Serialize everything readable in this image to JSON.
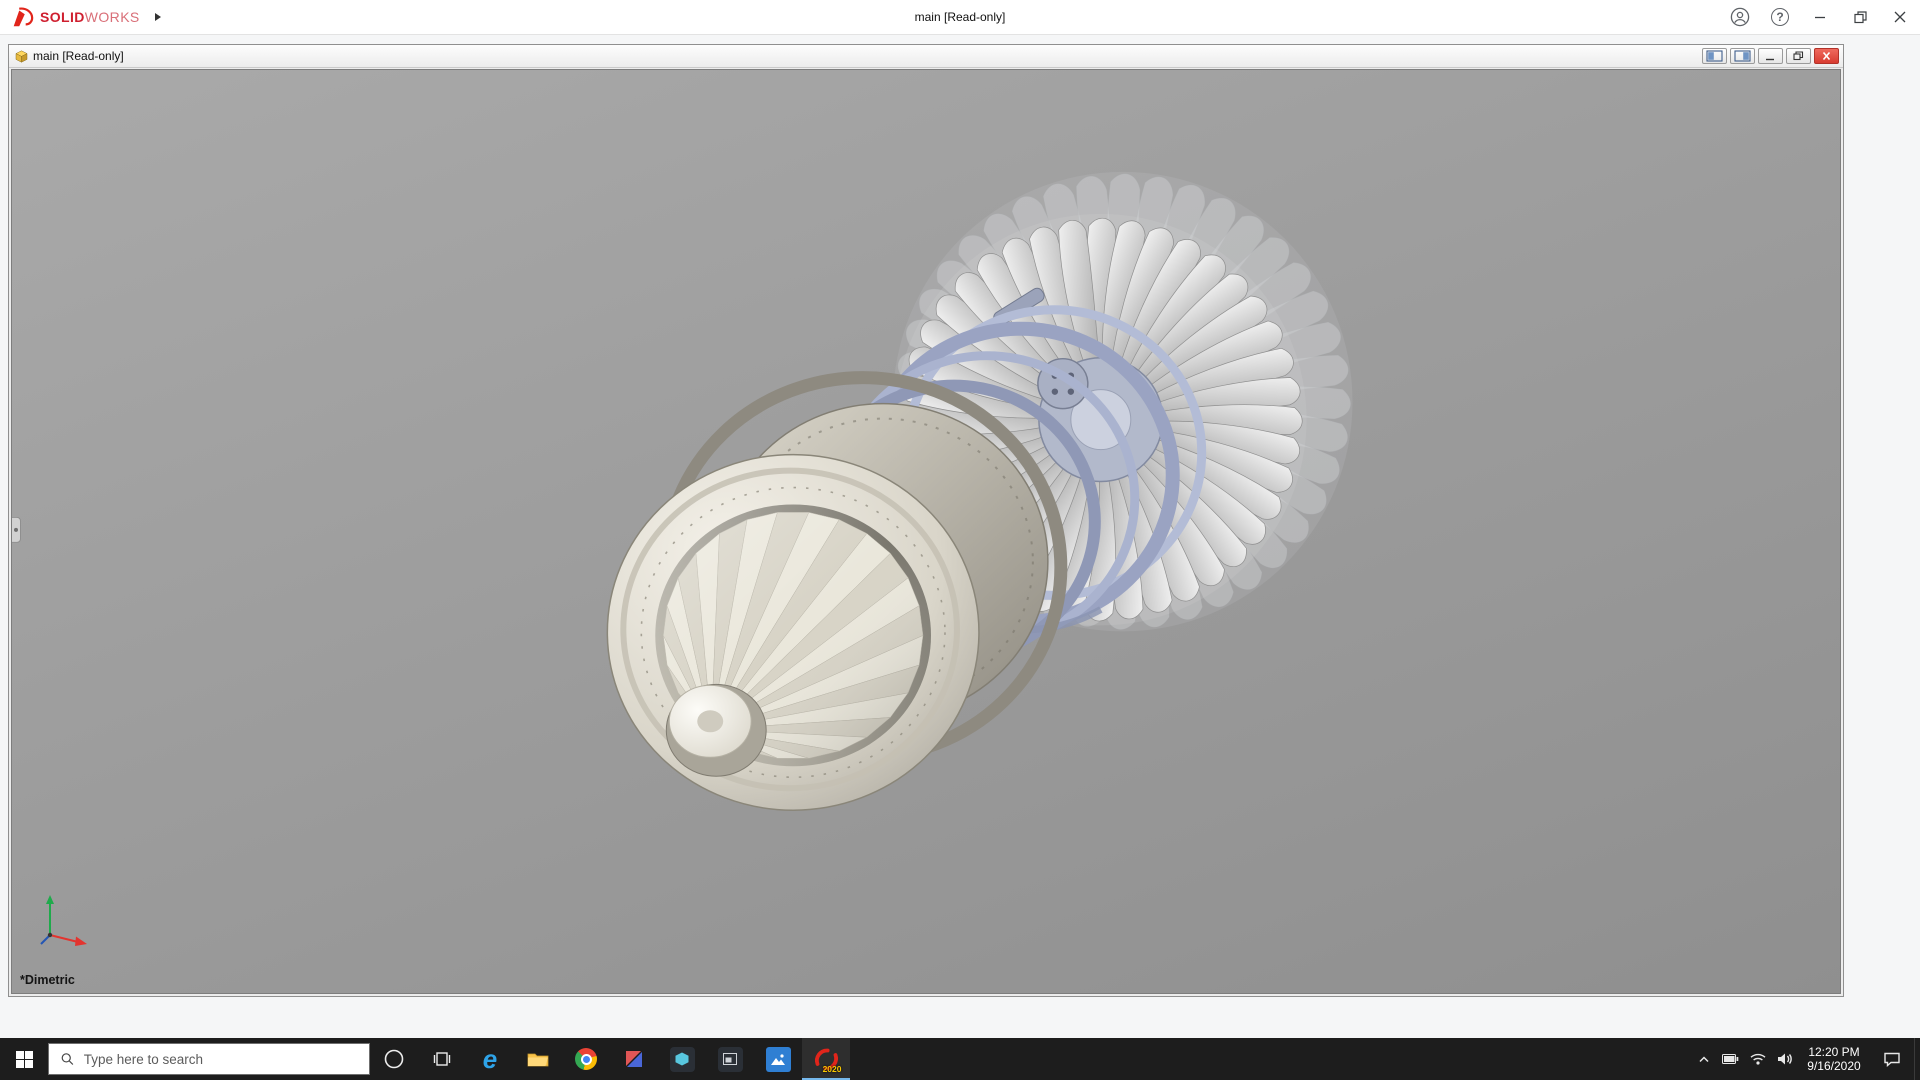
{
  "app": {
    "brand_bold": "SOLID",
    "brand_light": "WORKS",
    "title": "main [Read-only]"
  },
  "doc": {
    "title": "main [Read-only]"
  },
  "viewport": {
    "view_label": "*Dimetric"
  },
  "icons": {
    "help_glyph": "?",
    "edge_glyph": "e"
  },
  "taskbar": {
    "search_placeholder": "Type here to search",
    "sw_year_badge": "2020",
    "time": "12:20 PM",
    "date": "9/16/2020"
  },
  "colors": {
    "solidworks_red": "#cf1f2f",
    "close_button_red": "#d83b30",
    "taskbar_bg": "#1d1d1d",
    "viewport_gray": "#9d9d9d",
    "active_app_underline": "#76b9ed"
  }
}
